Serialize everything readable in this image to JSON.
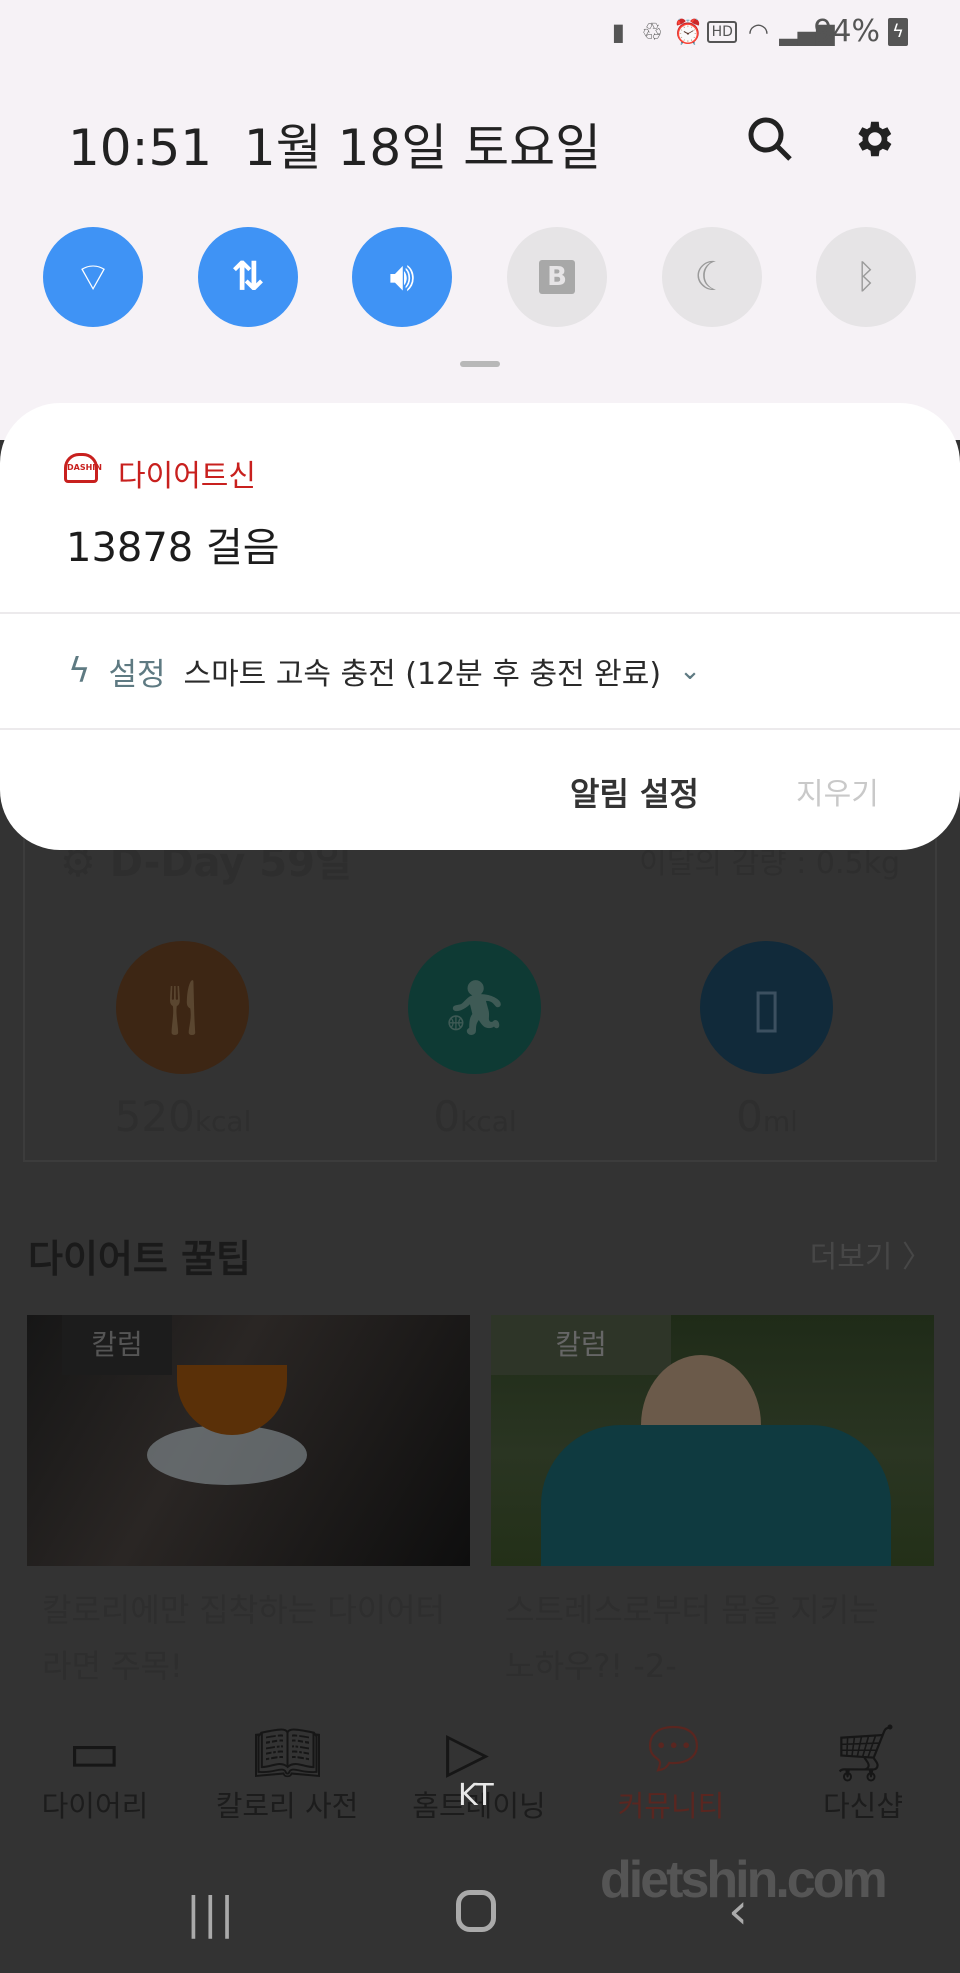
{
  "status_bar": {
    "battery": "94%",
    "icons": [
      "battery-saver-icon",
      "recycle-icon",
      "alarm-icon",
      "hd-voice-icon",
      "wifi-icon",
      "signal-icon",
      "battery-charging-icon"
    ]
  },
  "header": {
    "time": "10:51",
    "date": "1월 18일 토요일"
  },
  "quick_toggles": [
    {
      "name": "wifi",
      "on": true
    },
    {
      "name": "mobile-data",
      "on": true
    },
    {
      "name": "sound",
      "on": true
    },
    {
      "name": "bixby-routines",
      "on": false
    },
    {
      "name": "night-mode",
      "on": false
    },
    {
      "name": "bluetooth",
      "on": false
    }
  ],
  "colors": {
    "accent": "#3f93f5",
    "app_red": "#c8201e",
    "community_red": "#7a2a24"
  },
  "notification": {
    "app_name": "다이어트신",
    "text": "13878 걸음",
    "sub_app": "설정",
    "sub_text": "스마트 고속 충전 (12분 후 충전 완료)",
    "settings_button": "알림 설정",
    "clear_button": "지우기"
  },
  "app": {
    "dday": "D-Day 59일",
    "monthly_loss": "이달의 감량 : 0.5kg",
    "stats": [
      {
        "value": "520",
        "unit": "kcal"
      },
      {
        "value": "0",
        "unit": "kcal"
      },
      {
        "value": "0",
        "unit": "ml"
      }
    ],
    "tips_title": "다이어트 꿀팁",
    "more": "더보기",
    "articles": [
      {
        "tag": "칼럼",
        "title": "칼로리에만 집착하는 다이어터라면 주목!"
      },
      {
        "tag": "칼럼",
        "title": "스트레스로부터 몸을 지키는 노하우?! -2-"
      }
    ],
    "nav": [
      "다이어리",
      "칼로리 사전",
      "홈트레이닝",
      "커뮤니티",
      "다신샵"
    ],
    "carrier": "KT",
    "watermark": "dietshin.com"
  }
}
